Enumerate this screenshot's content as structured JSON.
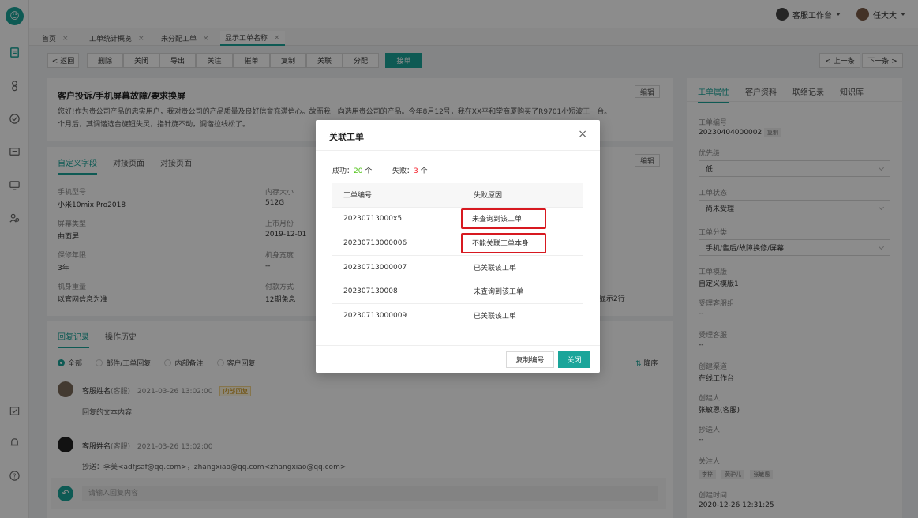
{
  "topbar": {
    "workspace": "客服工作台",
    "user": "任大大"
  },
  "page_tabs": [
    {
      "label": "首页"
    },
    {
      "label": "工单统计概览"
    },
    {
      "label": "未分配工单"
    },
    {
      "label": "显示工单名称"
    }
  ],
  "toolbar": {
    "back": "< 返回",
    "actions": [
      "删除",
      "关闭",
      "导出",
      "关注",
      "催单",
      "复制",
      "关联",
      "分配"
    ],
    "primary": "接单",
    "prev": "< 上一条",
    "next": "下一条 >"
  },
  "ticket": {
    "title": "客户投诉/手机屏幕故障/要求换屏",
    "edit": "编辑",
    "desc_line1": "您好!作为贵公司产品的忠实用户，我对贵公司的产品质量及良好信誉充满信心。故而我一向选用贵公司的产品。今年8月12号，我在XX平和堂商厦购买了R9701小短波王一台。一",
    "desc_line2": "个月后，其调谐选台旋钮失灵，指针旋不动，调谐拉线松了。"
  },
  "fields": {
    "tabs": [
      "自定义字段",
      "对接页面",
      "对接页面"
    ],
    "edit": "编辑",
    "items": [
      {
        "label": "手机型号",
        "value": "小米10mix Pro2018"
      },
      {
        "label": "内存大小",
        "value": "512G"
      },
      {
        "label": "屏幕类型",
        "value": "曲面屏"
      },
      {
        "label": "上市月份",
        "value": "2019-12-01"
      },
      {
        "label": "保修年限",
        "value": "3年"
      },
      {
        "label": "机身宽度",
        "value": "--"
      },
      {
        "label": "机身重量",
        "value": "以官网信息为准"
      },
      {
        "label": "付款方式",
        "value": "12期免息"
      }
    ],
    "overflow_text": "显示2行"
  },
  "replies": {
    "tabs": [
      "回复记录",
      "操作历史"
    ],
    "filters": [
      "全部",
      "邮件/工单回复",
      "内部备注",
      "客户回复"
    ],
    "sort": "降序",
    "items": [
      {
        "name": "客服姓名",
        "role": "(客服)",
        "time": "2021-03-26 13:02:00",
        "tag": "内部回复",
        "content": "回复的文本内容"
      },
      {
        "name": "客服姓名",
        "role": "(客服)",
        "time": "2021-03-26 13:02:00",
        "tag": "",
        "content": "抄送：李美<adfjsaf@qq.com>，zhangxiao@qq.com<zhangxiao@qq.com>"
      }
    ],
    "input_placeholder": "请输入回复内容"
  },
  "side": {
    "tabs": [
      "工单属性",
      "客户资料",
      "联络记录",
      "知识库"
    ],
    "ticket_no_label": "工单编号",
    "ticket_no": "20230404000002",
    "copy": "复制",
    "priority_label": "优先级",
    "priority": "低",
    "status_label": "工单状态",
    "status": "尚未受理",
    "category_label": "工单分类",
    "category": "手机/售后/故障换修/屏幕",
    "template_label": "工单模版",
    "template": "自定义模版1",
    "group_label": "受理客服组",
    "group": "--",
    "agent_label": "受理客服",
    "agent": "--",
    "channel_label": "创建渠道",
    "channel": "在线工作台",
    "creator_label": "创建人",
    "creator": "张敏恩(客服)",
    "cc_label": "抄送人",
    "cc": "--",
    "followers_label": "关注人",
    "followers": [
      "李梓",
      "黄驴儿",
      "张敏恩"
    ],
    "created_label": "创建时间",
    "created": "2020-12-26 12:31:25"
  },
  "modal": {
    "title": "关联工单",
    "success_label": "成功：",
    "success_count": "20",
    "success_unit": " 个",
    "fail_label": "失败：",
    "fail_count": "3",
    "fail_unit": " 个",
    "col_no": "工单编号",
    "col_reason": "失败原因",
    "rows": [
      {
        "no": "20230713000x5",
        "reason": "未查询到该工单",
        "highlight": true
      },
      {
        "no": "20230713000006",
        "reason": "不能关联工单本身",
        "highlight": true
      },
      {
        "no": "20230713000007",
        "reason": "已关联该工单",
        "highlight": false
      },
      {
        "no": "202307130008",
        "reason": "未查询到该工单",
        "highlight": false
      },
      {
        "no": "20230713000009",
        "reason": "已关联该工单",
        "highlight": false
      }
    ],
    "copy_btn": "复制编号",
    "close_btn": "关闭"
  }
}
